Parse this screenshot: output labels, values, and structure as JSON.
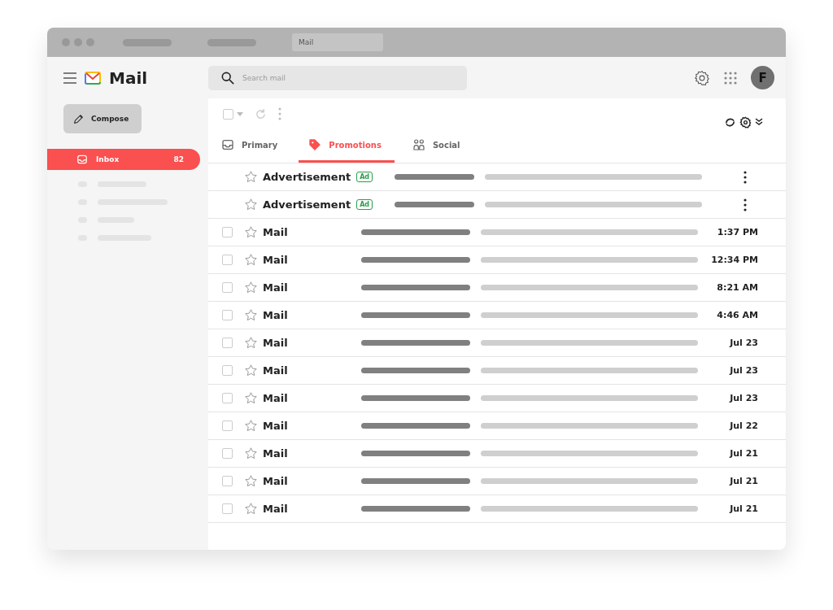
{
  "browser": {
    "tab_title": "Mail"
  },
  "app": {
    "name": "Mail"
  },
  "search": {
    "placeholder": "Search mail"
  },
  "toolbar": {
    "select_all_checked": false
  },
  "avatar": {
    "initial": "F"
  },
  "compose": {
    "label": "Compose"
  },
  "sidebar": {
    "items": [
      {
        "label": "Inbox",
        "count": "82",
        "selected": true
      }
    ]
  },
  "tabs": [
    {
      "label": "Primary",
      "kind": "inbox",
      "selected": false
    },
    {
      "label": "Promotions",
      "kind": "tag",
      "selected": true
    },
    {
      "label": "Social",
      "kind": "people",
      "selected": false
    }
  ],
  "messages": [
    {
      "kind": "ad",
      "sender": "Advertisement",
      "badge": "Ad"
    },
    {
      "kind": "ad",
      "sender": "Advertisement",
      "badge": "Ad"
    },
    {
      "kind": "mail",
      "sender": "Mail",
      "time": "1:37 PM",
      "checked": false
    },
    {
      "kind": "mail",
      "sender": "Mail",
      "time": "12:34 PM",
      "checked": false
    },
    {
      "kind": "mail",
      "sender": "Mail",
      "time": "8:21 AM",
      "checked": false
    },
    {
      "kind": "mail",
      "sender": "Mail",
      "time": "4:46 AM",
      "checked": false
    },
    {
      "kind": "mail",
      "sender": "Mail",
      "time": "Jul 23",
      "checked": false
    },
    {
      "kind": "mail",
      "sender": "Mail",
      "time": "Jul 23",
      "checked": false
    },
    {
      "kind": "mail",
      "sender": "Mail",
      "time": "Jul 23",
      "checked": false
    },
    {
      "kind": "mail",
      "sender": "Mail",
      "time": "Jul 22",
      "checked": false
    },
    {
      "kind": "mail",
      "sender": "Mail",
      "time": "Jul 21",
      "checked": false
    },
    {
      "kind": "mail",
      "sender": "Mail",
      "time": "Jul 21",
      "checked": false
    },
    {
      "kind": "mail",
      "sender": "Mail",
      "time": "Jul 21",
      "checked": false
    }
  ]
}
